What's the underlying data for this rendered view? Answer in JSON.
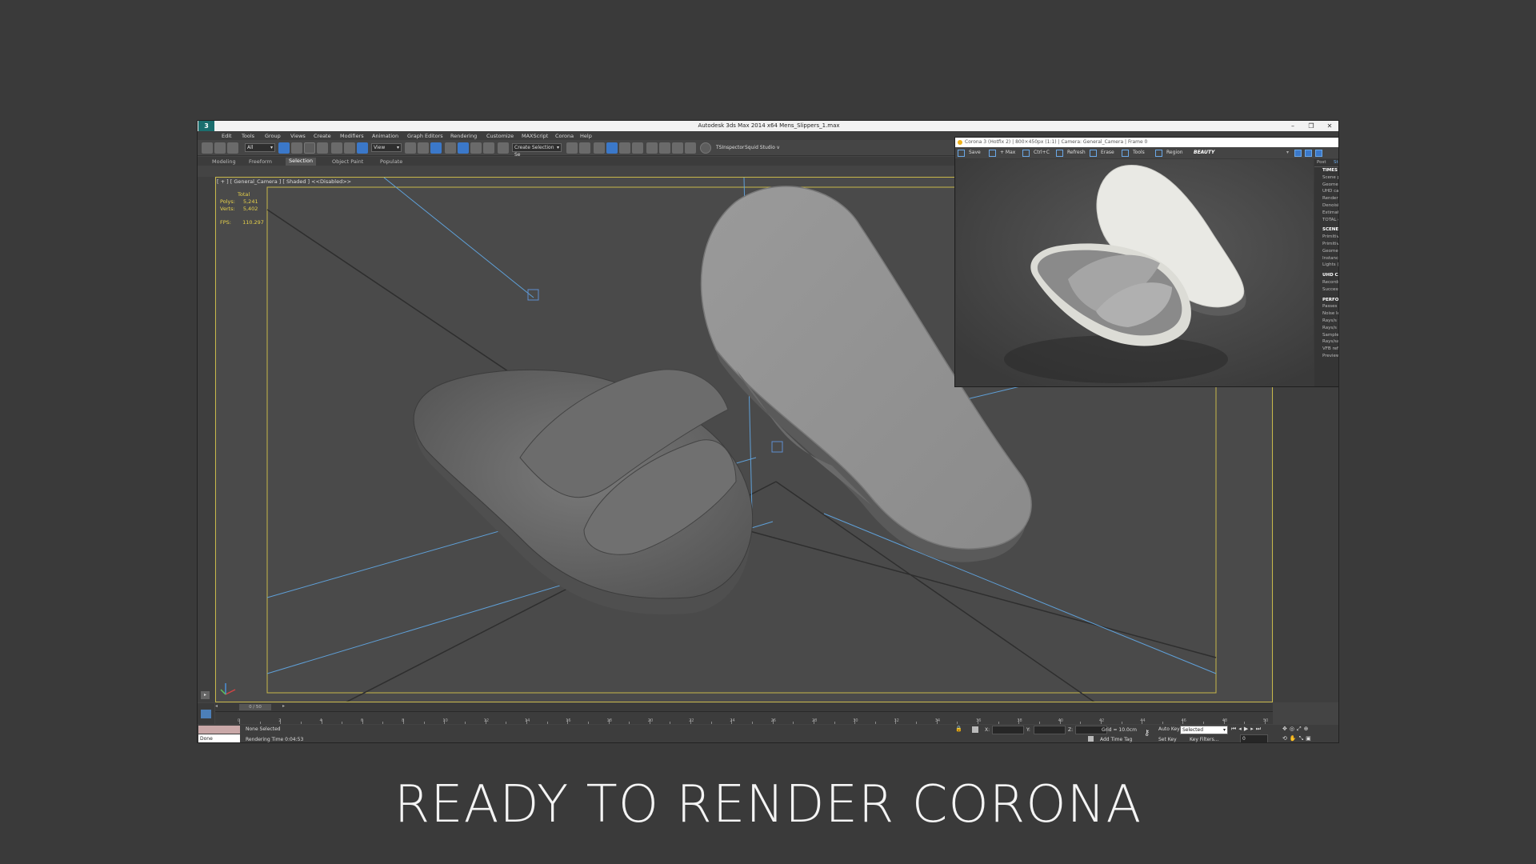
{
  "app": {
    "logo": "3",
    "title": "Autodesk 3ds Max  2014 x64     Mens_Slippers_1.max",
    "menu": [
      "Edit",
      "Tools",
      "Group",
      "Views",
      "Create",
      "Modifiers",
      "Animation",
      "Graph Editors",
      "Rendering",
      "Customize",
      "MAXScript",
      "Corona",
      "Help"
    ],
    "toolbar": {
      "filter_value": "All",
      "view_value": "View",
      "selection_set": "Create Selection Se",
      "tsinspector": "TSInspector",
      "squid": "Squid Studio v"
    },
    "ribbon_tabs": [
      "Modeling",
      "Freeform",
      "Selection",
      "Object Paint",
      "Populate"
    ],
    "ribbon_active": "Selection"
  },
  "viewport": {
    "label": "[ + ] [ General_Camera ] [ Shaded ]  <<Disabled>>",
    "stats": {
      "total_label": "Total",
      "polys_label": "Polys:",
      "polys_value": "5,241",
      "verts_label": "Verts:",
      "verts_value": "5,402",
      "fps_label": "FPS:",
      "fps_value": "110.297"
    }
  },
  "vfb": {
    "title": "Corona 3 (Hotfix 2) | 800×450px (1:1) | Camera: General_Camera | Frame 0",
    "toolbar": [
      "Save",
      "+ Max",
      "Ctrl+C",
      "Refresh",
      "Erase",
      "Tools",
      "Region",
      "BEAUTY"
    ],
    "side_tabs": [
      "Post",
      "St"
    ],
    "stats": [
      {
        "text": "TIMES",
        "header": true
      },
      {
        "text": "Scene pa"
      },
      {
        "text": "Geometr"
      },
      {
        "text": "UHD cac"
      },
      {
        "text": "Renderin"
      },
      {
        "text": "Denoisin"
      },
      {
        "text": "Estimate"
      },
      {
        "text": "TOTAL el"
      },
      {
        "text": "",
        "spacer": true
      },
      {
        "text": "SCENE",
        "header": true
      },
      {
        "text": "Primitive"
      },
      {
        "text": "Primitive"
      },
      {
        "text": "Geometr"
      },
      {
        "text": "Instance"
      },
      {
        "text": "Lights (g"
      },
      {
        "text": "",
        "spacer": true
      },
      {
        "text": "UHD CA",
        "header": true
      },
      {
        "text": "Records"
      },
      {
        "text": "Success r"
      },
      {
        "text": "",
        "spacer": true
      },
      {
        "text": "PERFOR",
        "header": true
      },
      {
        "text": "Passes to"
      },
      {
        "text": "Noise lev"
      },
      {
        "text": "Rays/s to"
      },
      {
        "text": "Rays/s a"
      },
      {
        "text": "Samples"
      },
      {
        "text": "Rays/sam"
      },
      {
        "text": "VFB refre"
      },
      {
        "text": "Preview"
      }
    ]
  },
  "timeline": {
    "frame_counter": "0 / 50",
    "ticks": [
      "0",
      "2",
      "4",
      "6",
      "8",
      "10",
      "12",
      "14",
      "16",
      "18",
      "20",
      "22",
      "24",
      "26",
      "28",
      "30",
      "32",
      "34",
      "36",
      "38",
      "40",
      "42",
      "44",
      "46",
      "48",
      "50"
    ]
  },
  "status": {
    "listener_value": "Done",
    "selection": "None Selected",
    "rendering_time": "Rendering Time  0:04:53",
    "x_label": "X:",
    "y_label": "Y:",
    "z_label": "Z:",
    "grid": "Grid = 10.0cm",
    "add_time_tag": "Add Time Tag",
    "auto_key": "Auto Key",
    "auto_key_value": "Selected",
    "set_key": "Set Key",
    "key_filters": "Key Filters...",
    "frame_value": "0"
  },
  "caption": "READY TO RENDER  CORONA",
  "colors": {
    "background": "#3a3a3a",
    "viewport_border": "#c8b84a",
    "stats_text": "#e8d24a",
    "camera_lines": "#5fa0d8"
  }
}
